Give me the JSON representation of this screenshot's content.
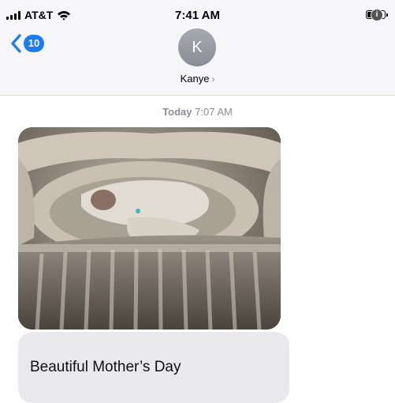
{
  "status_bar": {
    "carrier": "AT&T",
    "time": "7:41 AM",
    "battery_badge": "i"
  },
  "nav": {
    "back_count": "10",
    "avatar_initial": "K",
    "contact_name": "Kanye",
    "contact_chevron": "›"
  },
  "thread": {
    "timestamp_day": "Today",
    "timestamp_time": "7:07 AM",
    "messages": [
      {
        "type": "photo",
        "alt": "baby-in-crib"
      },
      {
        "type": "text",
        "text": "Beautiful Mother’s Day"
      }
    ]
  },
  "colors": {
    "accent": "#1a7cf5",
    "header_bg": "#f6f6f8",
    "bubble_bg": "#e9e9eb",
    "secondary_text": "#8e8e93"
  },
  "icons": [
    "signal-icon",
    "wifi-icon",
    "battery-icon",
    "back-chevron-icon",
    "chevron-right-icon"
  ]
}
